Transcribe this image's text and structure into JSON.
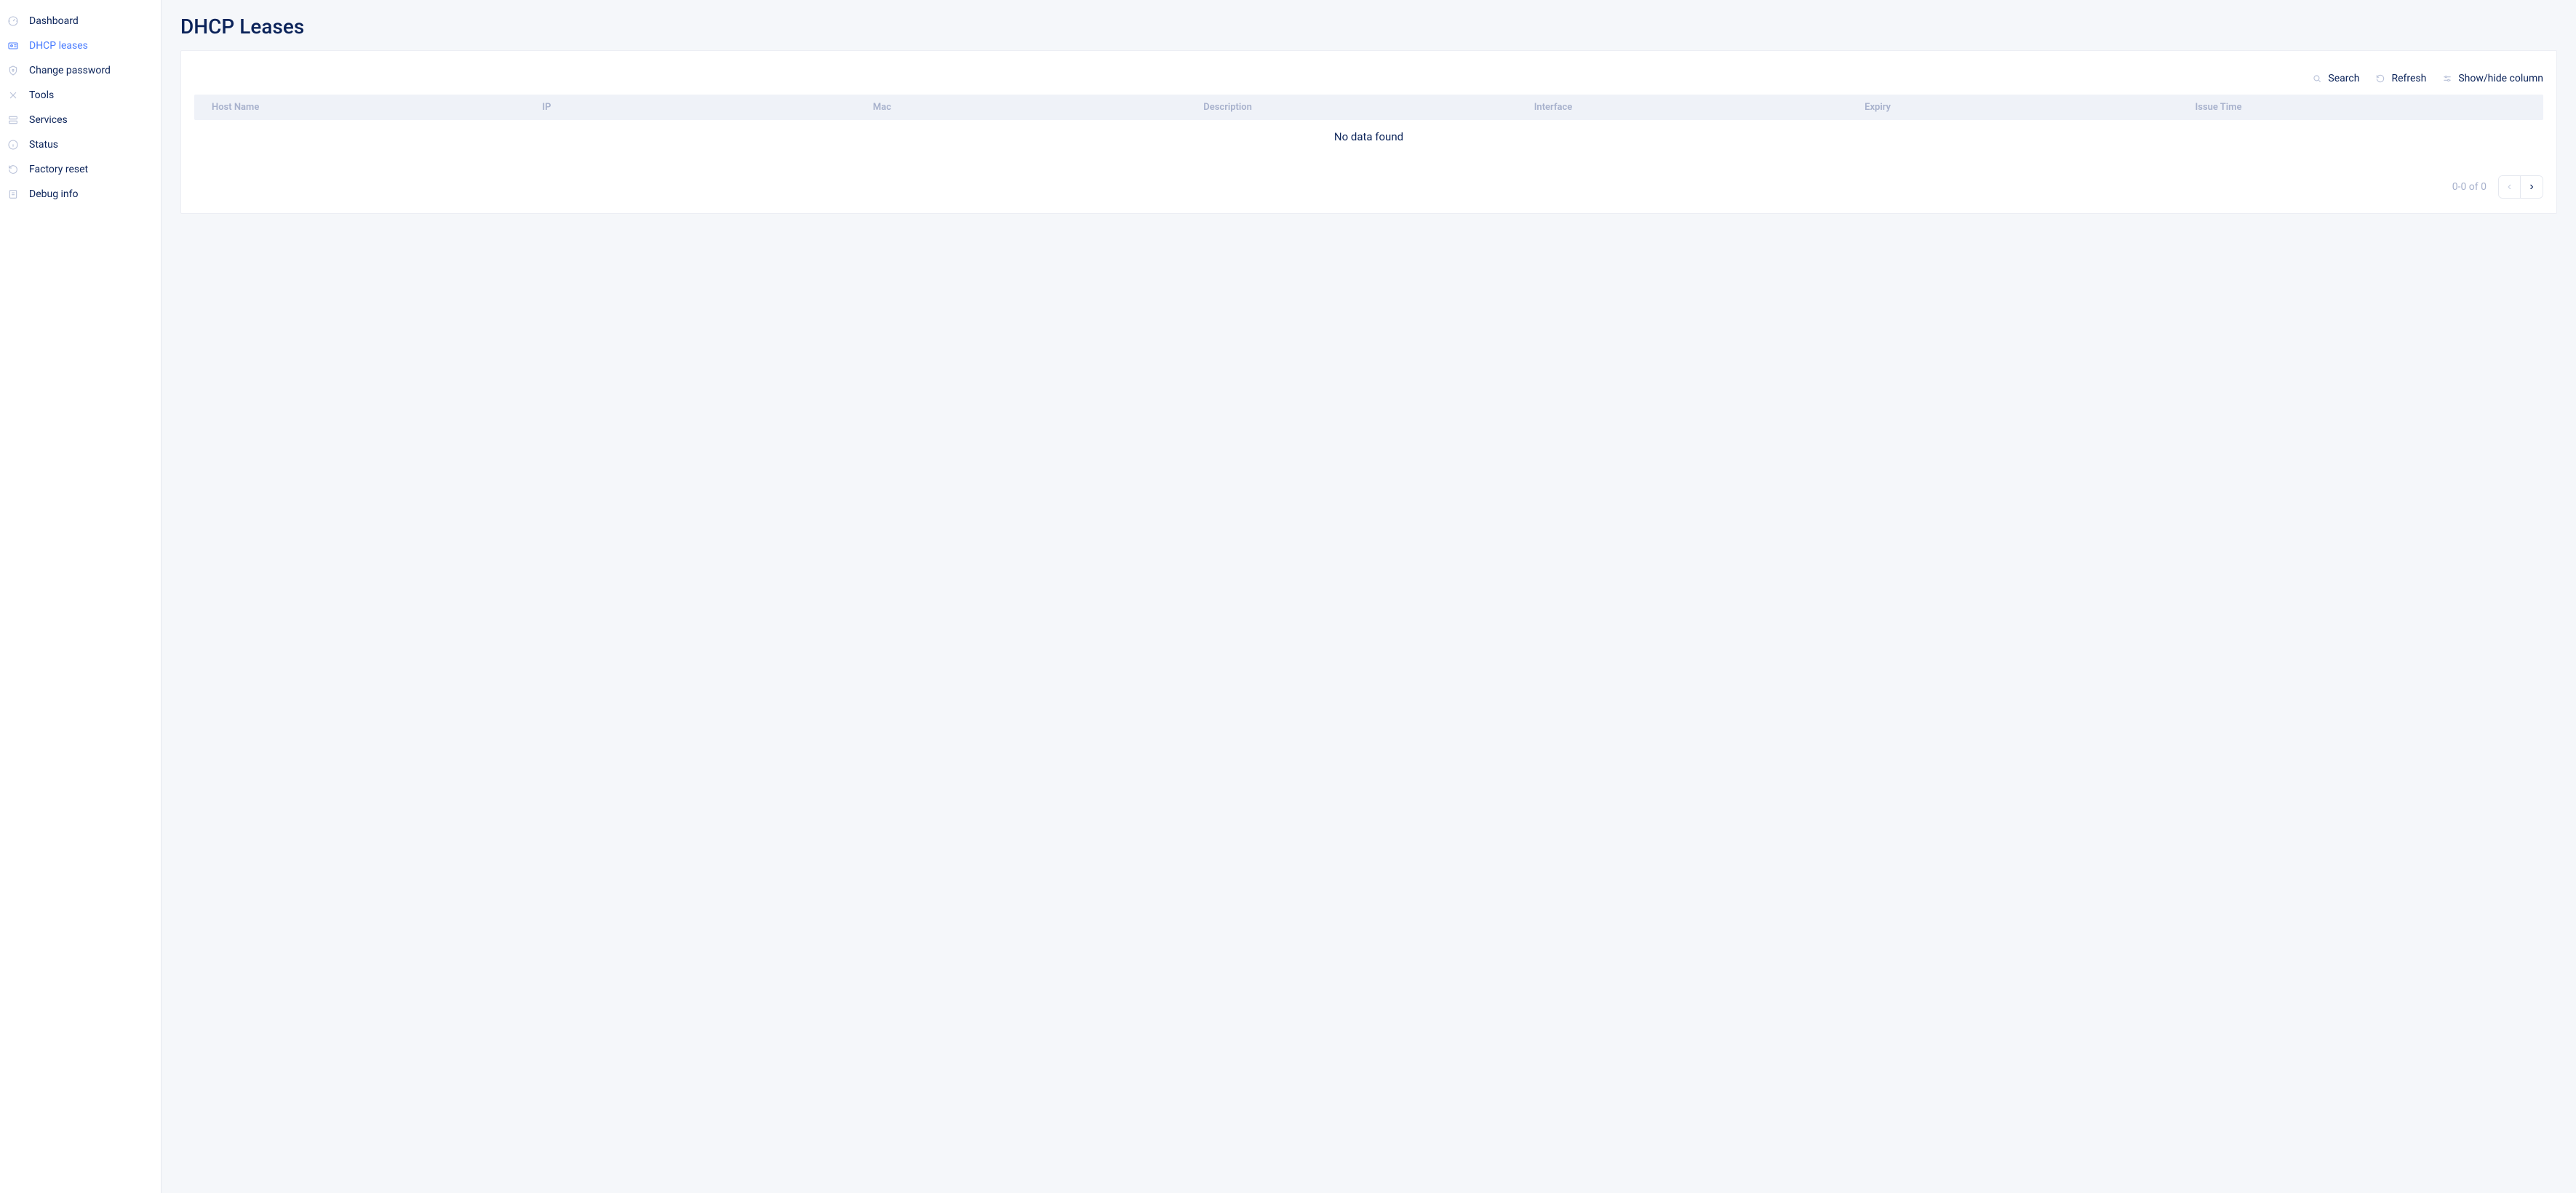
{
  "sidebar": {
    "items": [
      {
        "id": "dashboard",
        "label": "Dashboard",
        "icon": "gauge-icon"
      },
      {
        "id": "dhcp-leases",
        "label": "DHCP leases",
        "icon": "id-card-icon",
        "active": true
      },
      {
        "id": "change-password",
        "label": "Change password",
        "icon": "shield-lock-icon"
      },
      {
        "id": "tools",
        "label": "Tools",
        "icon": "tools-icon"
      },
      {
        "id": "services",
        "label": "Services",
        "icon": "servers-icon"
      },
      {
        "id": "status",
        "label": "Status",
        "icon": "info-circle-icon"
      },
      {
        "id": "factory-reset",
        "label": "Factory reset",
        "icon": "reset-icon"
      },
      {
        "id": "debug-info",
        "label": "Debug info",
        "icon": "note-icon"
      }
    ]
  },
  "page": {
    "title": "DHCP Leases"
  },
  "toolbar": {
    "search_label": "Search",
    "refresh_label": "Refresh",
    "columns_label": "Show/hide column"
  },
  "table": {
    "columns": [
      {
        "label": "Host Name"
      },
      {
        "label": "IP"
      },
      {
        "label": "Mac"
      },
      {
        "label": "Description"
      },
      {
        "label": "Interface"
      },
      {
        "label": "Expiry"
      },
      {
        "label": "Issue Time"
      }
    ],
    "rows": [],
    "empty_text": "No data found"
  },
  "pagination": {
    "range_text": "0-0 of 0"
  }
}
